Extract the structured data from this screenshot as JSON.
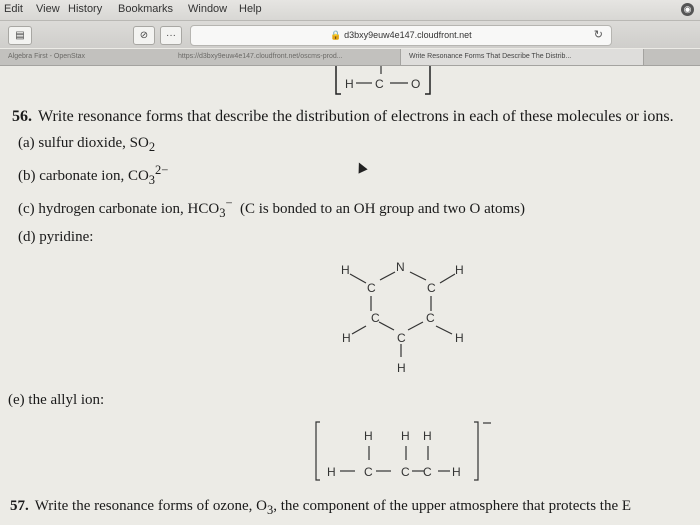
{
  "menubar": {
    "items": [
      "Edit",
      "View",
      "History",
      "Bookmarks",
      "Window",
      "Help"
    ]
  },
  "toolbar": {
    "url": "d3bxy9euw4e147.cloudfront.net"
  },
  "tabs": [
    {
      "label": "Algebra First - OpenStax",
      "active": false
    },
    {
      "label": "https://d3bxy9euw4e147.cloudfront.net/oscms-prod...",
      "active": false
    },
    {
      "label": "Write Resonance Forms That Describe The Distrib...",
      "active": true
    }
  ],
  "doc": {
    "top_fragment": {
      "left": "H",
      "center": "C",
      "right": "O"
    },
    "q56": {
      "number": "56.",
      "text": "Write resonance forms that describe the distribution of electrons in each of these molecules or ions."
    },
    "parts": {
      "a": {
        "prefix": "(a) sulfur dioxide, SO",
        "sub": "2"
      },
      "b": {
        "prefix": "(b) carbonate ion, CO",
        "sub": "3",
        "sup": "2−"
      },
      "c": {
        "prefix": "(c) hydrogen carbonate ion, HCO",
        "sub": "3",
        "sup": "−",
        "suffix": "(C is bonded to an OH group and two O atoms)"
      },
      "d": {
        "text": "(d) pyridine:"
      },
      "e": {
        "text": "(e) the allyl ion:"
      }
    },
    "pyridine": {
      "atoms": [
        "H",
        "N",
        "H",
        "C",
        "C",
        "C",
        "C",
        "C",
        "H",
        "H",
        "H"
      ]
    },
    "allyl": {
      "top_h": [
        "H",
        "H",
        "H"
      ],
      "chain": [
        "H",
        "C",
        "C",
        "C",
        "H"
      ]
    },
    "q57": {
      "number": "57.",
      "text_before": "Write the resonance forms of ozone, O",
      "sub": "3",
      "text_after": ", the component of the upper atmosphere that protects the E"
    }
  }
}
